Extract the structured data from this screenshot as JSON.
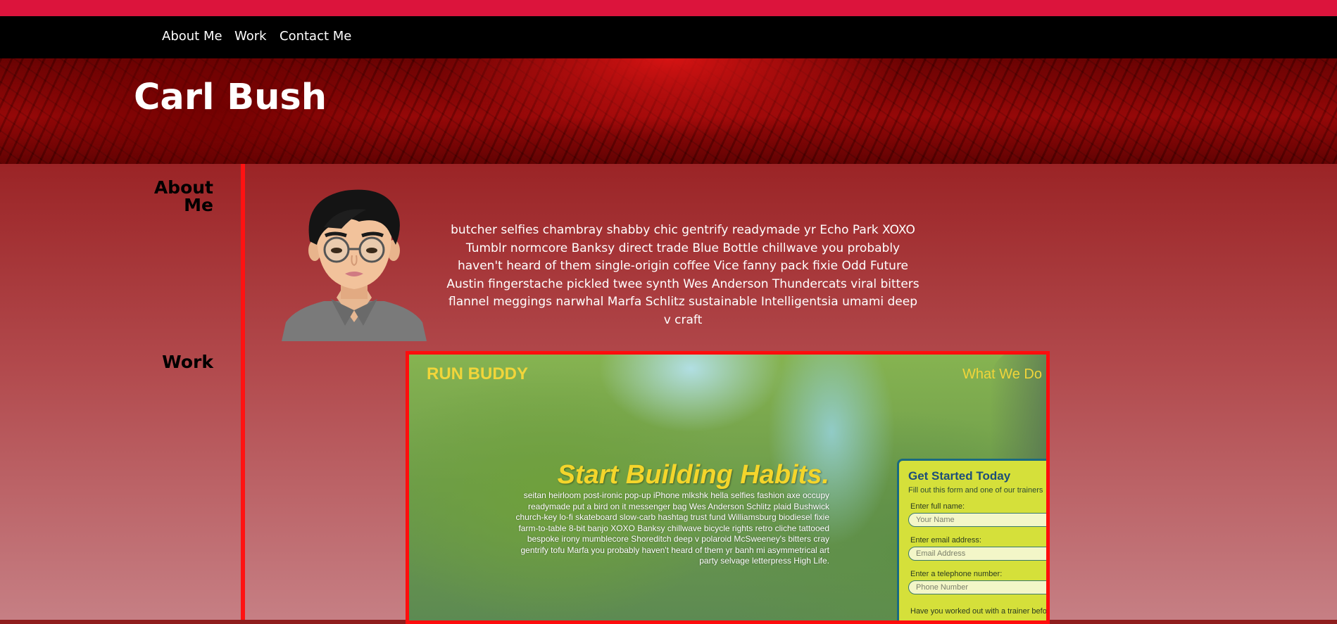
{
  "nav": {
    "links": [
      "About Me",
      "Work",
      "Contact Me"
    ]
  },
  "header": {
    "title": "Carl Bush"
  },
  "about": {
    "label": "About Me",
    "text": "butcher selfies chambray shabby chic gentrify readymade yr Echo Park XOXO Tumblr normcore Banksy direct trade Blue Bottle chillwave you probably haven't heard of them single-origin coffee Vice fanny pack fixie Odd Future Austin fingerstache pickled twee synth Wes Anderson Thundercats viral bitters flannel meggings narwhal Marfa Schlitz sustainable Intelligentsia umami deep v craft"
  },
  "work": {
    "label": "Work",
    "project": {
      "logo": "RUN BUDDY",
      "nav_item": "What We Do",
      "headline": "Start Building Habits.",
      "body": "seitan heirloom post-ironic pop-up iPhone mlkshk hella selfies fashion axe occupy readymade put a bird on it messenger bag Wes Anderson Schlitz plaid Bushwick church-key lo-fi skateboard slow-carb hashtag trust fund Williamsburg biodiesel fixie farm-to-table 8-bit banjo XOXO Banksy chillwave bicycle rights retro cliche tattooed bespoke irony mumblecore Shoreditch deep v polaroid McSweeney's bitters cray gentrify tofu Marfa you probably haven't heard of them yr banh mi asymmetrical art party selvage letterpress High Life.",
      "form": {
        "title": "Get Started Today",
        "subtitle": "Fill out this form and one of our trainers",
        "name_label": "Enter full name:",
        "name_placeholder": "Your Name",
        "email_label": "Enter email address:",
        "email_placeholder": "Email Address",
        "phone_label": "Enter a telephone number:",
        "phone_placeholder": "Phone Number",
        "question": "Have you worked out with a trainer before"
      }
    }
  },
  "colors": {
    "top_strip": "#dc143c",
    "nav_bg": "#000000",
    "accent_red": "#ff1212",
    "runbuddy_yellow": "#f1d53a"
  }
}
